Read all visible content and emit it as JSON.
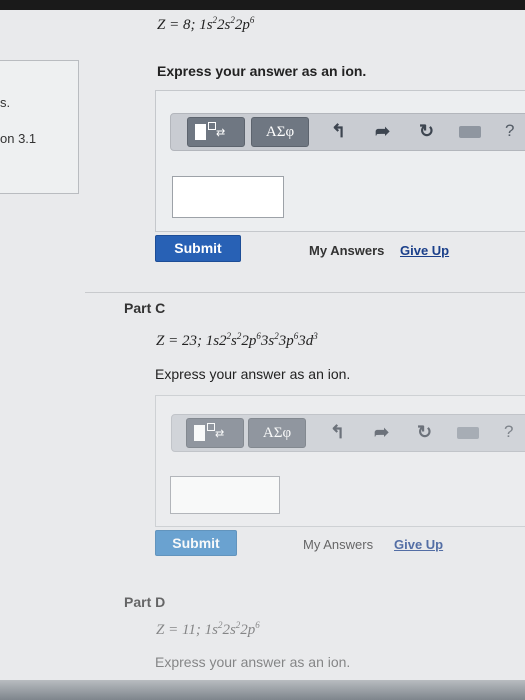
{
  "left_panel": {
    "line1": "s.",
    "line2": "on 3.1"
  },
  "part_b": {
    "formula_prefix": "Z = 8; 1s",
    "sup1": "2",
    "mid1": "2s",
    "sup2": "2",
    "mid2": "2p",
    "sup3": "6",
    "prompt": "Express your answer as an ion.",
    "submit": "Submit",
    "my_answers": "My Answers",
    "give_up": "Give Up"
  },
  "part_c": {
    "label": "Part C",
    "formula_prefix": "Z = 23; 1s2",
    "sup1": "2",
    "mid1": "s",
    "sup2": "2",
    "mid2": "2p",
    "sup3": "6",
    "mid3": "3s",
    "sup4": "2",
    "mid4": "3p",
    "sup5": "6",
    "mid5": "3d",
    "sup6": "3",
    "prompt": "Express your answer as an ion.",
    "submit": "Submit",
    "my_answers": "My Answers",
    "give_up": "Give Up"
  },
  "part_d": {
    "label": "Part D",
    "formula_prefix": "Z = 11; 1s",
    "sup1": "2",
    "mid1": "2s",
    "sup2": "2",
    "mid2": "2p",
    "sup3": "6",
    "prompt": "Express your answer as an ion."
  },
  "toolbar": {
    "template_arrows": "⇄",
    "greek": "ΑΣφ",
    "undo": "↰",
    "redo": "➦",
    "reset": "↻",
    "help": "?"
  },
  "icons": {
    "template": "template-icon",
    "undo": "undo-icon",
    "redo": "redo-icon",
    "reset": "reset-icon",
    "keyboard": "keyboard-icon",
    "help": "help-icon"
  },
  "colors": {
    "submit": "#2861b5",
    "link": "#1a3f8a"
  }
}
